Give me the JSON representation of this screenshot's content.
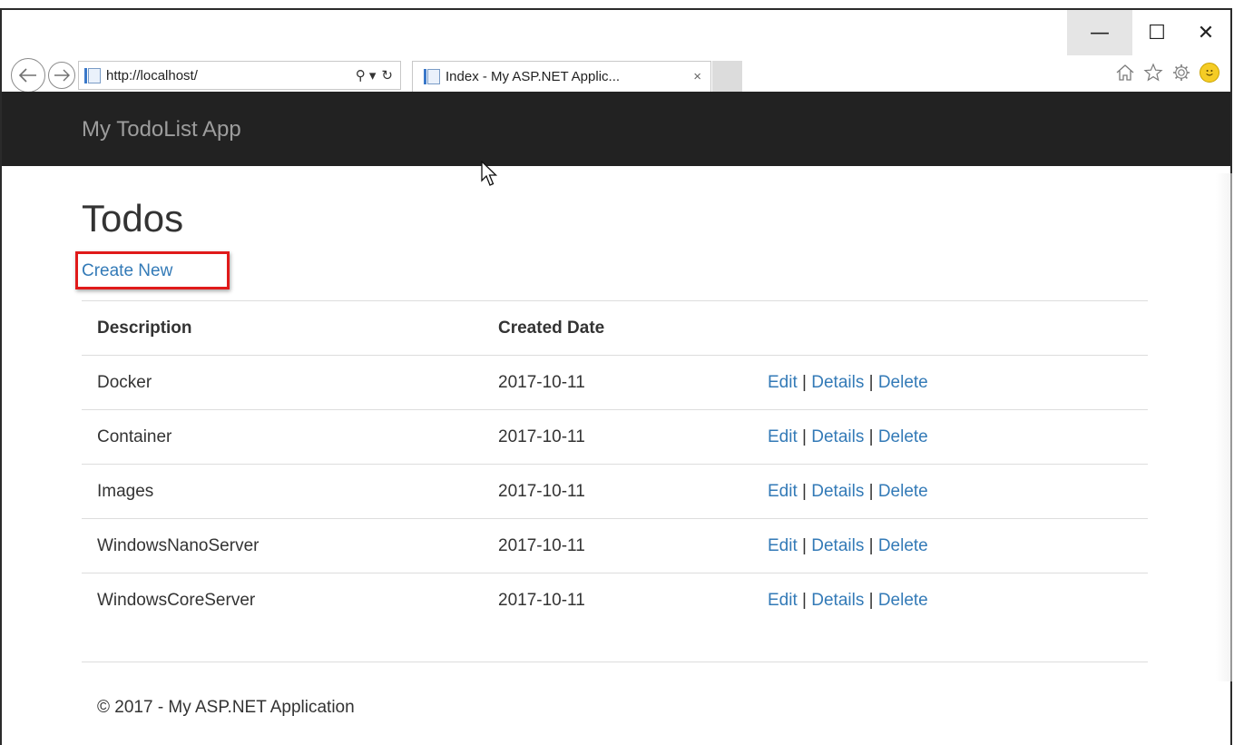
{
  "browser": {
    "url": "http://localhost/",
    "tab_title": "Index - My ASP.NET Applic...",
    "tab_close": "×",
    "search_glyph": "⚲ ▾",
    "refresh_glyph": "↻",
    "window_controls": {
      "minimize": "—",
      "maximize": "☐",
      "close": "✕"
    },
    "toolbar_icons": [
      "home-icon",
      "favorites-star-icon",
      "settings-gear-icon",
      "feedback-smiley-icon"
    ]
  },
  "app": {
    "brand": "My TodoList App",
    "page_title": "Todos",
    "create_new_label": "Create New",
    "table": {
      "headers": [
        "Description",
        "Created Date",
        ""
      ],
      "rows": [
        {
          "description": "Docker",
          "created": "2017-10-11"
        },
        {
          "description": "Container",
          "created": "2017-10-11"
        },
        {
          "description": "Images",
          "created": "2017-10-11"
        },
        {
          "description": "WindowsNanoServer",
          "created": "2017-10-11"
        },
        {
          "description": "WindowsCoreServer",
          "created": "2017-10-11"
        }
      ],
      "actions": {
        "edit": "Edit",
        "details": "Details",
        "delete": "Delete",
        "separator": "|"
      }
    },
    "footer": "© 2017 - My ASP.NET Application"
  },
  "colors": {
    "navbar_bg": "#222222",
    "brand_text": "#9d9d9d",
    "link": "#337ab7",
    "highlight_box": "#e01a1a"
  }
}
